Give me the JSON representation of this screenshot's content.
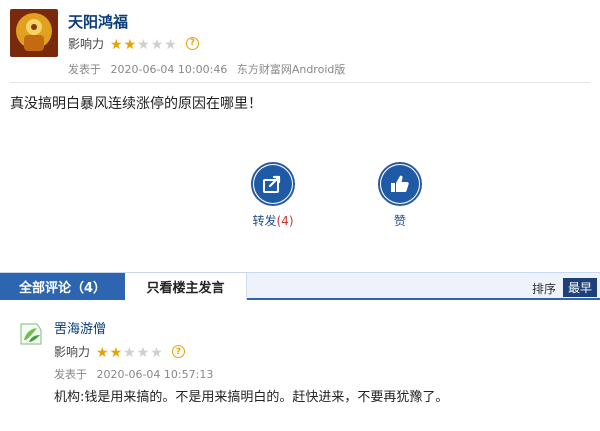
{
  "post": {
    "author": "天阳鸿福",
    "influence_label": "影响力",
    "rating": 2,
    "rating_max": 5,
    "help": "?",
    "posted_label": "发表于",
    "posted_time": "2020-06-04 10:00:46",
    "source": "东方财富网Android版",
    "content": "真没搞明白暴风连续涨停的原因在哪里！"
  },
  "actions": {
    "share_label": "转发",
    "share_count": "(4)",
    "like_label": "赞"
  },
  "tabs": {
    "all_comments": "全部评论（4）",
    "author_only": "只看楼主发言",
    "sort_label": "排序",
    "sort_latest": "最早"
  },
  "comments": [
    {
      "author": "罟海游僧",
      "influence_label": "影响力",
      "rating": 2,
      "rating_max": 5,
      "help": "?",
      "posted_label": "发表于",
      "posted_time": "2020-06-04 10:57:13",
      "text": "机构:钱是用来搞的。不是用来搞明白的。赶快进来，不要再犹豫了。"
    }
  ],
  "colors": {
    "accent": "#2e65b0",
    "link": "#0a3d7a",
    "star": "#e6a300"
  }
}
